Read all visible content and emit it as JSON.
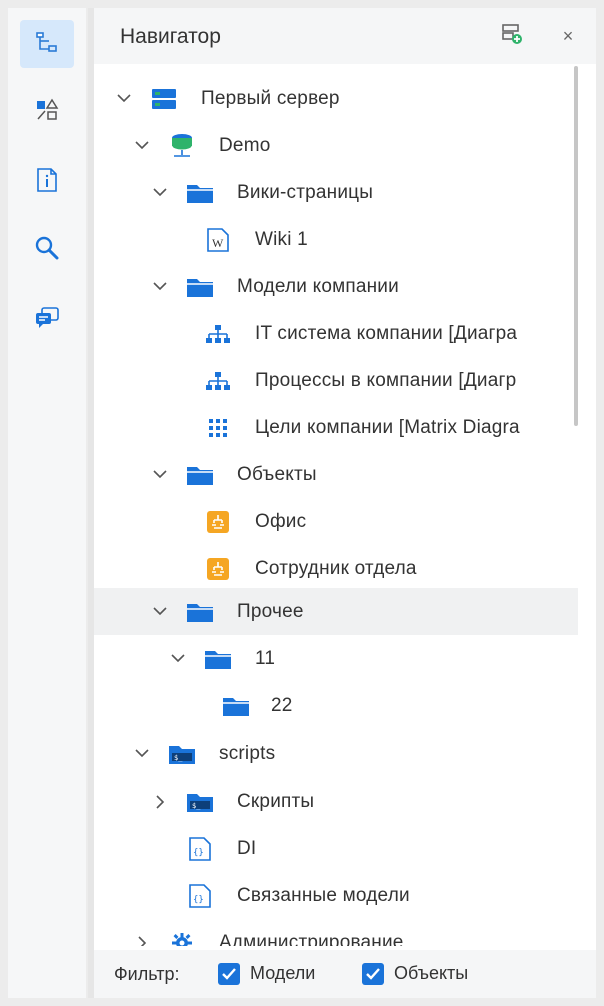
{
  "navigator": {
    "title": "Навигатор",
    "close_glyph": "×"
  },
  "rail": {
    "items": [
      {
        "icon": "tree-icon",
        "active": true
      },
      {
        "icon": "shapes-icon",
        "active": false
      },
      {
        "icon": "info-doc-icon",
        "active": false
      },
      {
        "icon": "search-icon",
        "active": false
      },
      {
        "icon": "chat-icon",
        "active": false
      }
    ]
  },
  "tree": {
    "items": [
      {
        "label": "Первый сервер",
        "icon": "server-icon",
        "expanded": true
      },
      {
        "label": "Demo",
        "icon": "database-icon",
        "expanded": true
      },
      {
        "label": "Вики-страницы",
        "icon": "folder-icon",
        "expanded": true
      },
      {
        "label": "Wiki 1",
        "icon": "wiki-doc-icon"
      },
      {
        "label": "Модели компании",
        "icon": "folder-icon",
        "expanded": true
      },
      {
        "label": "IT система компании [Диагра",
        "icon": "hierarchy-diagram-icon"
      },
      {
        "label": "Процессы в компании [Диагр",
        "icon": "hierarchy-diagram-icon"
      },
      {
        "label": "Цели компании [Matrix Diagra",
        "icon": "matrix-diagram-icon"
      },
      {
        "label": "Объекты",
        "icon": "folder-icon",
        "expanded": true
      },
      {
        "label": "Офис",
        "icon": "object-badge-icon"
      },
      {
        "label": "Сотрудник отдела",
        "icon": "object-badge-icon"
      },
      {
        "label": "Прочее",
        "icon": "folder-icon",
        "expanded": true
      },
      {
        "label": "11",
        "icon": "folder-icon",
        "expanded": true
      },
      {
        "label": "22",
        "icon": "folder-icon"
      },
      {
        "label": "scripts",
        "icon": "script-folder-icon",
        "expanded": true
      },
      {
        "label": "Скрипты",
        "icon": "script-folder-icon",
        "expanded": false
      },
      {
        "label": "DI",
        "icon": "json-doc-icon"
      },
      {
        "label": "Связанные модели",
        "icon": "json-doc-icon"
      },
      {
        "label": "Администрирование",
        "icon": "gear-icon",
        "expanded": false
      }
    ]
  },
  "filter": {
    "label": "Фильтр:",
    "models": {
      "label": "Модели",
      "checked": true
    },
    "objects": {
      "label": "Объекты",
      "checked": true
    }
  },
  "colors": {
    "accent": "#1a73d9",
    "server_green": "#2fb36b",
    "object_orange": "#f5a623"
  }
}
